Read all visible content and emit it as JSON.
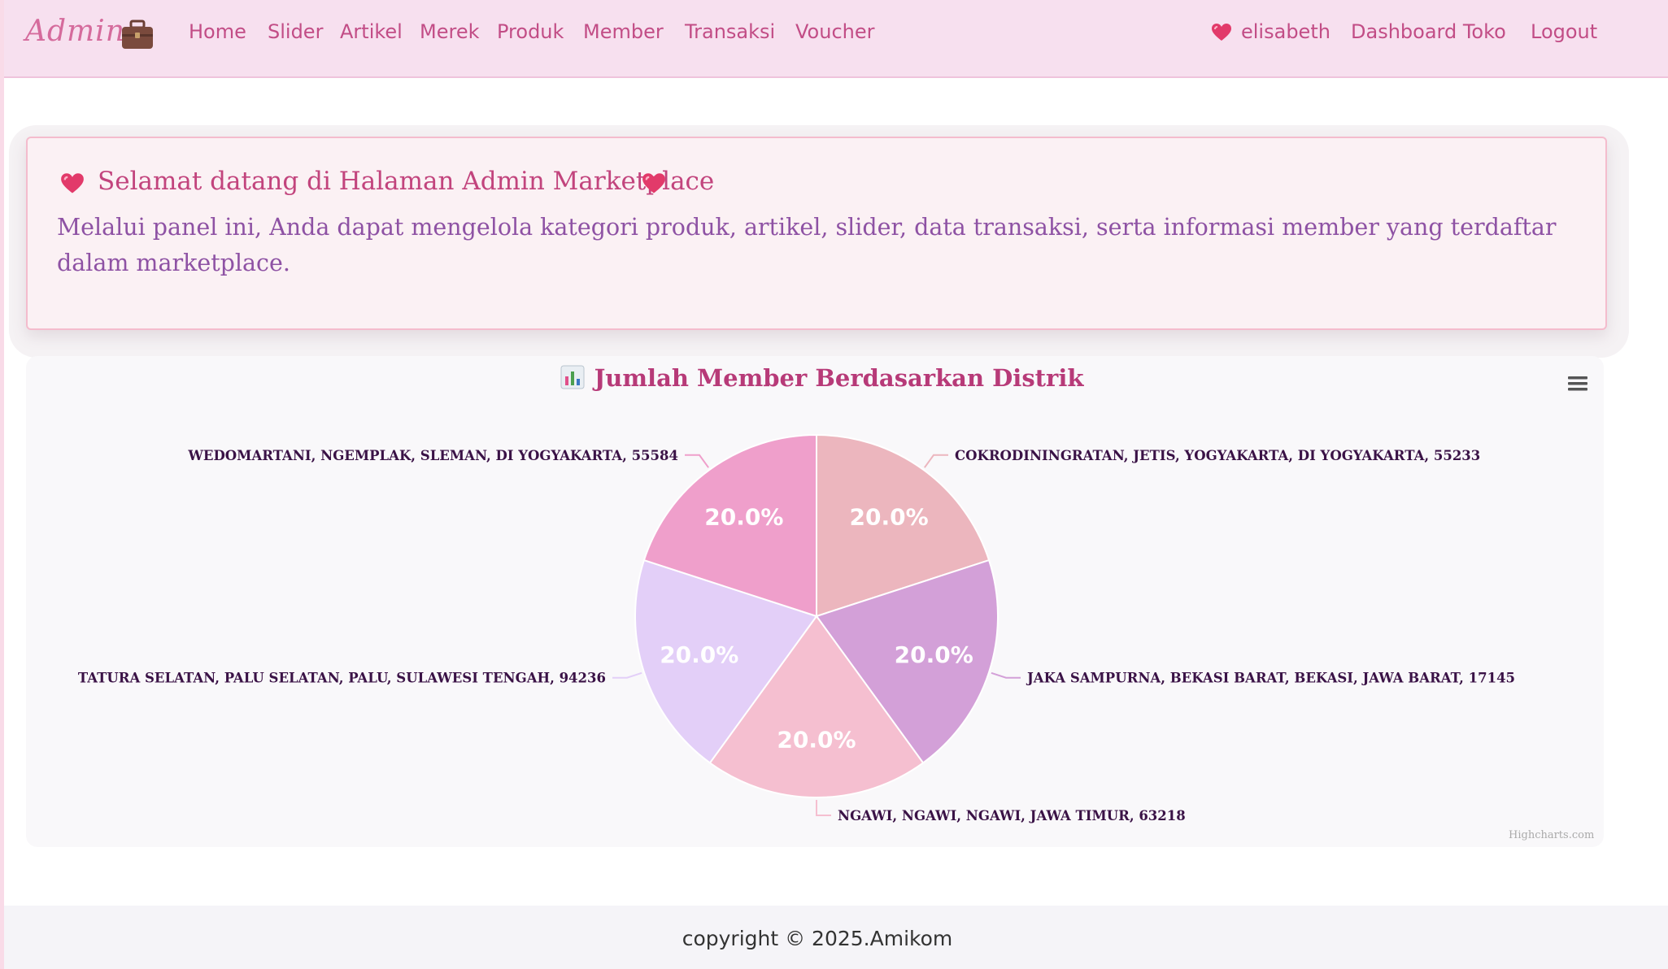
{
  "navbar": {
    "brand": "Admin",
    "brand_icon": "briefcase-icon",
    "links": [
      "Home",
      "Slider",
      "Artikel",
      "Merek",
      "Produk",
      "Member",
      "Transaksi",
      "Voucher"
    ],
    "user": "elisabeth",
    "dashboard_link": "Dashboard Toko",
    "logout": "Logout",
    "accent_color": "#c24d86",
    "background_color": "#f7e0ef"
  },
  "welcome": {
    "title": "Selamat datang di Halaman Admin Marketplace",
    "title_icon": "heart-icon",
    "body": "Melalui panel ini, Anda dapat mengelola kategori produk, artikel, slider, data transaksi, serta informasi member yang terdaftar dalam marketplace."
  },
  "chart": {
    "title_icon": "bar-chart-icon",
    "menu_icon": "menu-icon",
    "credits": "Highcharts.com"
  },
  "chart_data": {
    "type": "pie",
    "title": "Jumlah Member Berdasarkan Distrik",
    "slices": [
      {
        "name": "COKRODININGRATAN, JETIS, YOGYAKARTA, DI YOGYAKARTA, 55233",
        "value": 1,
        "percent_label": "20.0%",
        "color": "#ecb6be"
      },
      {
        "name": "JAKA SAMPURNA, BEKASI BARAT, BEKASI, JAWA BARAT, 17145",
        "value": 1,
        "percent_label": "20.0%",
        "color": "#d3a0d8"
      },
      {
        "name": "NGAWI, NGAWI, NGAWI, JAWA TIMUR, 63218",
        "value": 1,
        "percent_label": "20.0%",
        "color": "#f5bfd0"
      },
      {
        "name": "TATURA SELATAN, PALU SELATAN, PALU, SULAWESI TENGAH, 94236",
        "value": 1,
        "percent_label": "20.0%",
        "color": "#e3cff8"
      },
      {
        "name": "WEDOMARTANI, NGEMPLAK, SLEMAN, DI YOGYAKARTA, 55584",
        "value": 1,
        "percent_label": "20.0%",
        "color": "#ef9fcb"
      }
    ]
  },
  "footer": {
    "copyright": "copyright © 2025.Amikom"
  }
}
